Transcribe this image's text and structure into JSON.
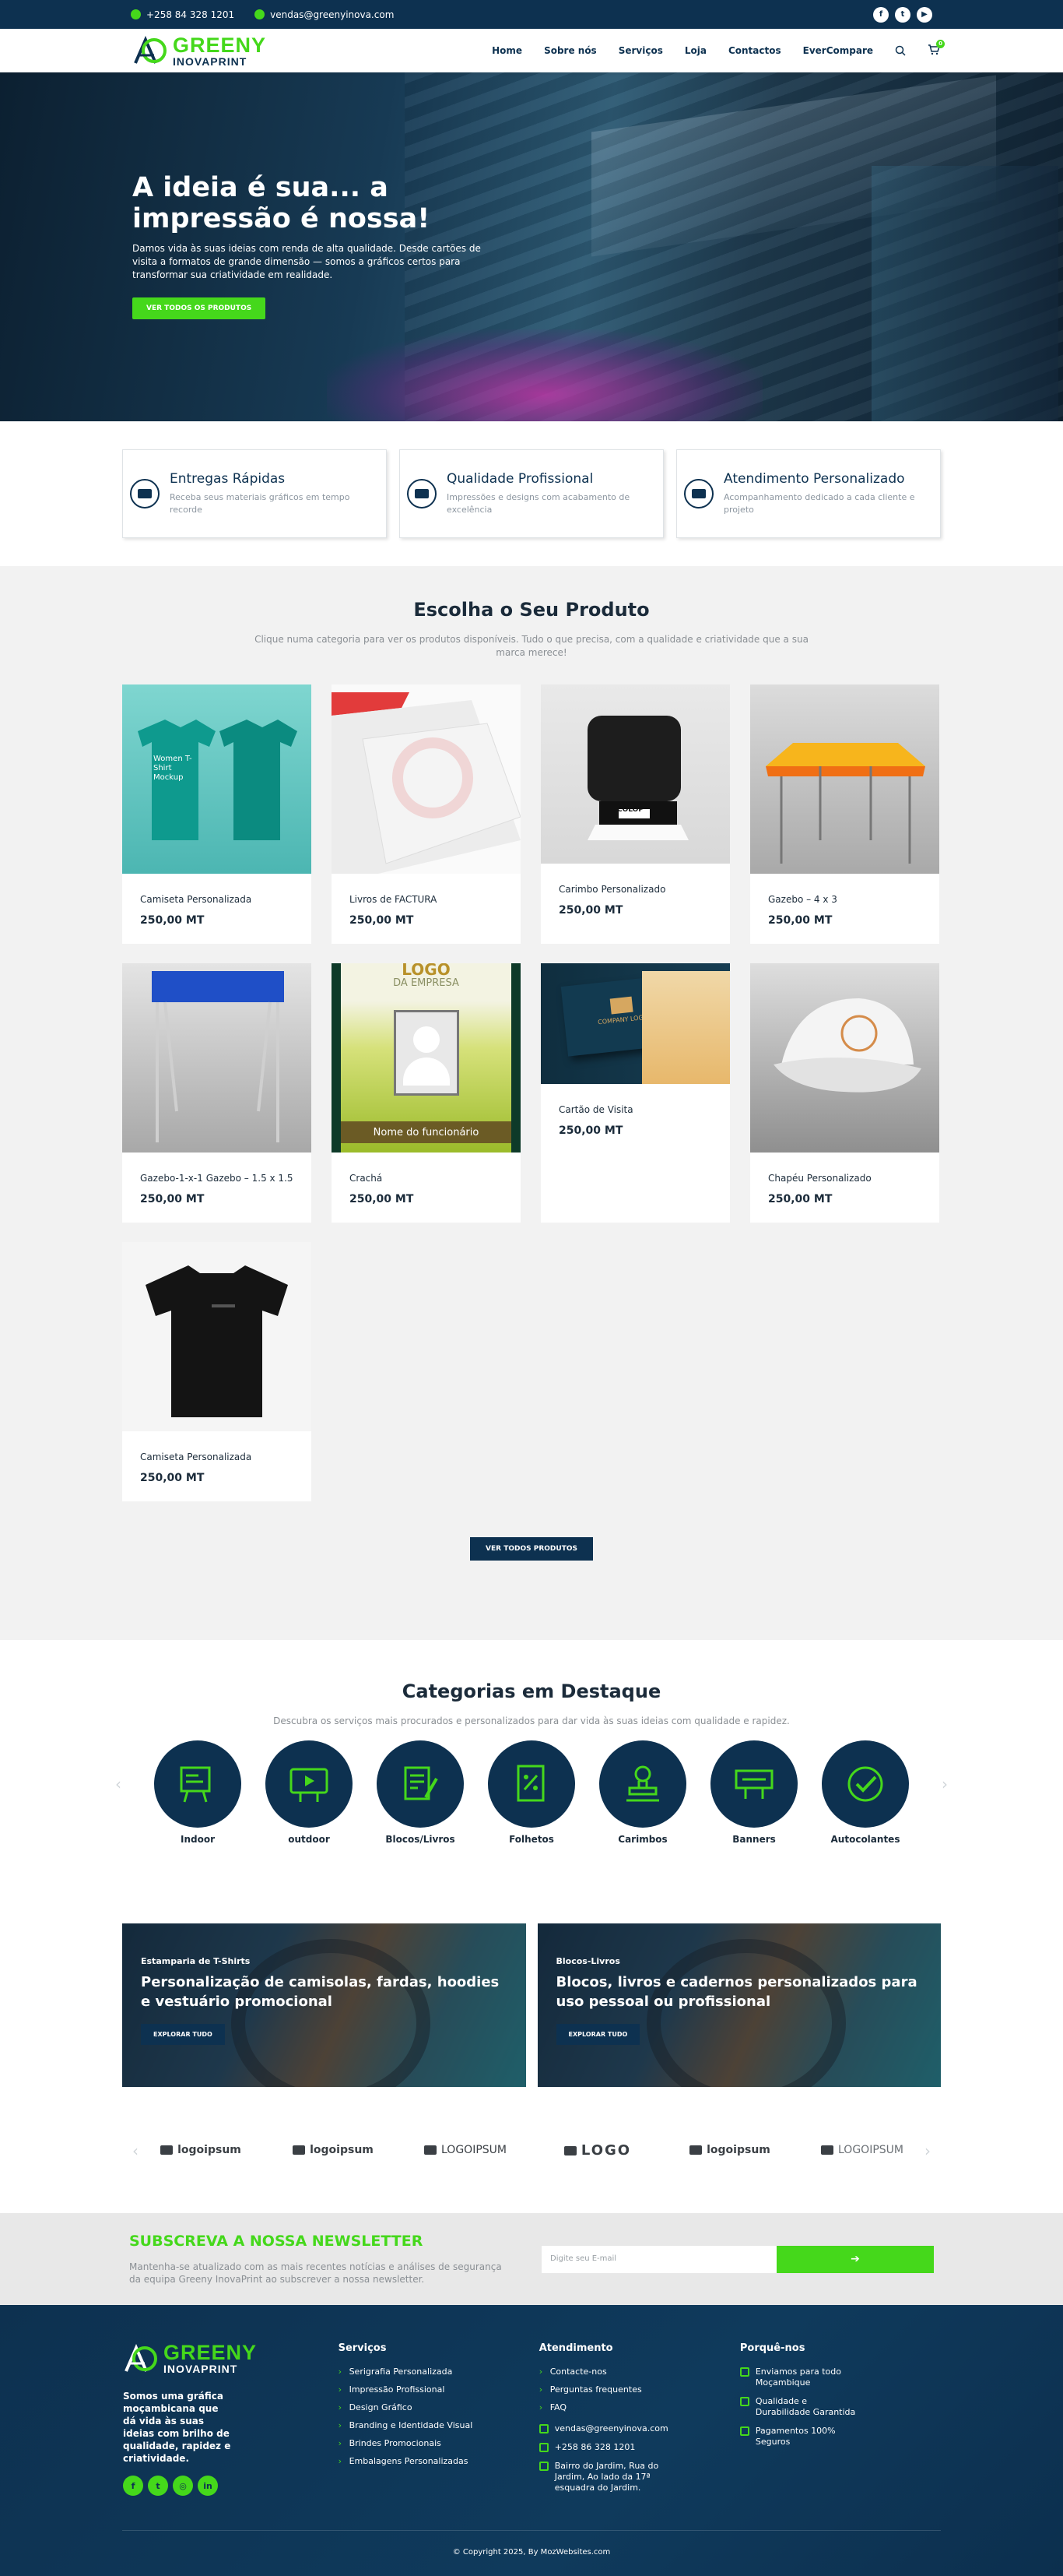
{
  "topbar": {
    "phone": "+258 84 328 1201",
    "email": "vendas@greenyinova.com",
    "social": [
      "facebook-icon",
      "twitter-icon",
      "youtube-icon"
    ]
  },
  "logo": {
    "line1": "GREENY",
    "line2": "INOVAPRINT"
  },
  "nav": {
    "items": [
      "Home",
      "Sobre nós",
      "Serviços",
      "Loja",
      "Contactos",
      "EverCompare"
    ],
    "cart_count": "0"
  },
  "hero": {
    "title": "A ideia é sua... a impressão é nossa!",
    "text": "Damos vida às suas ideias com renda de alta qualidade. Desde cartões de visita a formatos de grande dimensão — somos a gráficos certos para transformar sua criatividade em realidade.",
    "button": "VER TODOS OS PRODUTOS"
  },
  "features": [
    {
      "title": "Entregas Rápidas",
      "text": "Receba seus materiais gráficos em tempo recorde",
      "icon": "truck-icon"
    },
    {
      "title": "Qualidade Profissional",
      "text": "Impressões e designs com acabamento de excelência",
      "icon": "printer-icon"
    },
    {
      "title": "Atendimento Personalizado",
      "text": "Acompanhamento dedicado a cada cliente e projeto",
      "icon": "support-icon"
    }
  ],
  "products": {
    "title": "Escolha o Seu Produto",
    "subtitle": "Clique numa categoria para ver os produtos disponíveis. Tudo o que precisa, com a qualidade e criatividade que a sua marca merece!",
    "items": [
      {
        "name": "Camiseta Personalizada",
        "price": "250,00 MT"
      },
      {
        "name": "Livros de FACTURA",
        "price": "250,00 MT"
      },
      {
        "name": "Carimbo Personalizado",
        "price": "250,00 MT"
      },
      {
        "name": "Gazebo – 4 x 3",
        "price": "250,00 MT"
      },
      {
        "name": "Gazebo-1-x-1 Gazebo – 1.5 x 1.5",
        "price": "250,00 MT"
      },
      {
        "name": "Crachá",
        "price": "250,00 MT"
      },
      {
        "name": "Cartão de Visita",
        "price": "250,00 MT"
      },
      {
        "name": "Chapéu Personalizado",
        "price": "250,00 MT"
      },
      {
        "name": "Camiseta Personalizada",
        "price": "250,00 MT"
      }
    ],
    "image_text": {
      "tshirt_mockup": "Women T-Shirt Mockup",
      "badge_logo": "LOGO",
      "badge_company": "DA EMPRESA",
      "badge_employee": "Nome do funcionário",
      "card_company": "COMPANY LOGO",
      "stamp_brand": "COLOP"
    },
    "button": "VER TODOS PRODUTOS"
  },
  "categories": {
    "title": "Categorias em Destaque",
    "subtitle": "Descubra os serviços mais procurados e personalizados para dar vida às suas ideias com qualidade e rapidez.",
    "items": [
      "Indoor",
      "outdoor",
      "Blocos/Livros",
      "Folhetos",
      "Carimbos",
      "Banners",
      "Autocolantes"
    ]
  },
  "banners": [
    {
      "tag": "Estamparia de T-Shirts",
      "title": "Personalização de camisolas, fardas, hoodies e vestuário promocional",
      "button": "EXPLORAR TUDO"
    },
    {
      "tag": "Blocos-Livros",
      "title": "Blocos, livros e cadernos personalizados para uso pessoal ou profissional",
      "button": "EXPLORAR TUDO"
    }
  ],
  "partner_logos": [
    "logoipsum",
    "logoipsum",
    "LOGOIPSUM",
    "LOGO",
    "logoipsum",
    "LOGOIPSUM"
  ],
  "newsletter": {
    "title": "SUBSCREVA A NOSSA NEWSLETTER",
    "text": "Mantenha-se atualizado com as mais recentes notícias e análises de segurança da equipa Greeny InovaPrint ao subscrever a nossa newsletter.",
    "placeholder": "Digite seu E-mail",
    "button": "➔"
  },
  "footer": {
    "about": "Somos uma gráfica moçambicana que dá vida às suas ideias com brilho de qualidade, rapidez e criatividade.",
    "services_title": "Serviços",
    "services": [
      "Serigrafia Personalizada",
      "Impressão Profissional",
      "Design Gráfico",
      "Branding e Identidade Visual",
      "Brindes Promocionais",
      "Embalagens Personalizadas"
    ],
    "support_title": "Atendimento",
    "support": [
      "Contacte-nos",
      "Perguntas frequentes",
      "FAQ"
    ],
    "contact_email": "vendas@greenyinova.com",
    "contact_phone": "+258 86 328 1201",
    "contact_address": "Bairro do Jardim, Rua do Jardim, Ao lado da 17ª esquadra do Jardim.",
    "why_title": "Porquê-nos",
    "why": [
      "Enviamos para todo Moçambique",
      "Qualidade e Durabilidade Garantida",
      "Pagamentos 100% Seguros"
    ],
    "copyright": "© Copyright 2025, By MozWebsites.com"
  },
  "colors": {
    "primary": "#0d3150",
    "accent": "#45d81b",
    "light_bg": "#f2f2f2"
  }
}
